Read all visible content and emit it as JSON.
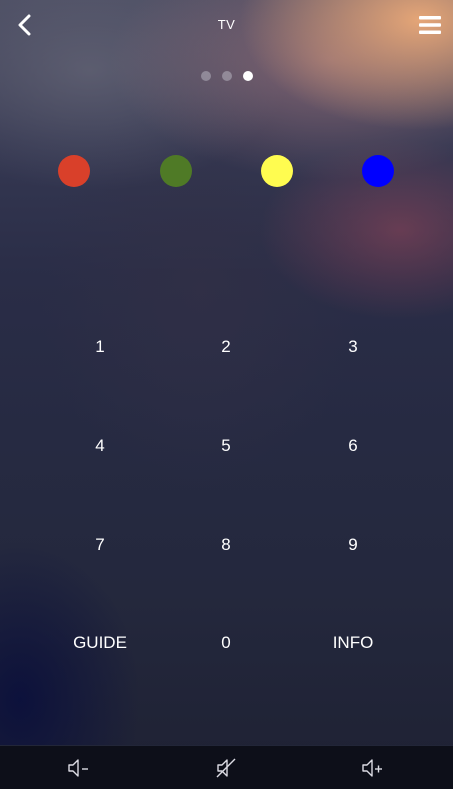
{
  "header": {
    "title": "TV",
    "back_icon": "chevron-left-icon",
    "menu_icon": "hamburger-menu-icon"
  },
  "pager": {
    "pages": 3,
    "active_index": 2
  },
  "color_buttons": [
    {
      "name": "red",
      "color": "#d9402a"
    },
    {
      "name": "green",
      "color": "#4f7a26"
    },
    {
      "name": "yellow",
      "color": "#fffc50"
    },
    {
      "name": "blue",
      "color": "#0000ff"
    }
  ],
  "keypad": {
    "keys": [
      "1",
      "2",
      "3",
      "4",
      "5",
      "6",
      "7",
      "8",
      "9",
      "GUIDE",
      "0",
      "INFO"
    ]
  },
  "footer": {
    "volume_down_icon": "volume-down-icon",
    "mute_icon": "mute-icon",
    "volume_up_icon": "volume-up-icon"
  }
}
